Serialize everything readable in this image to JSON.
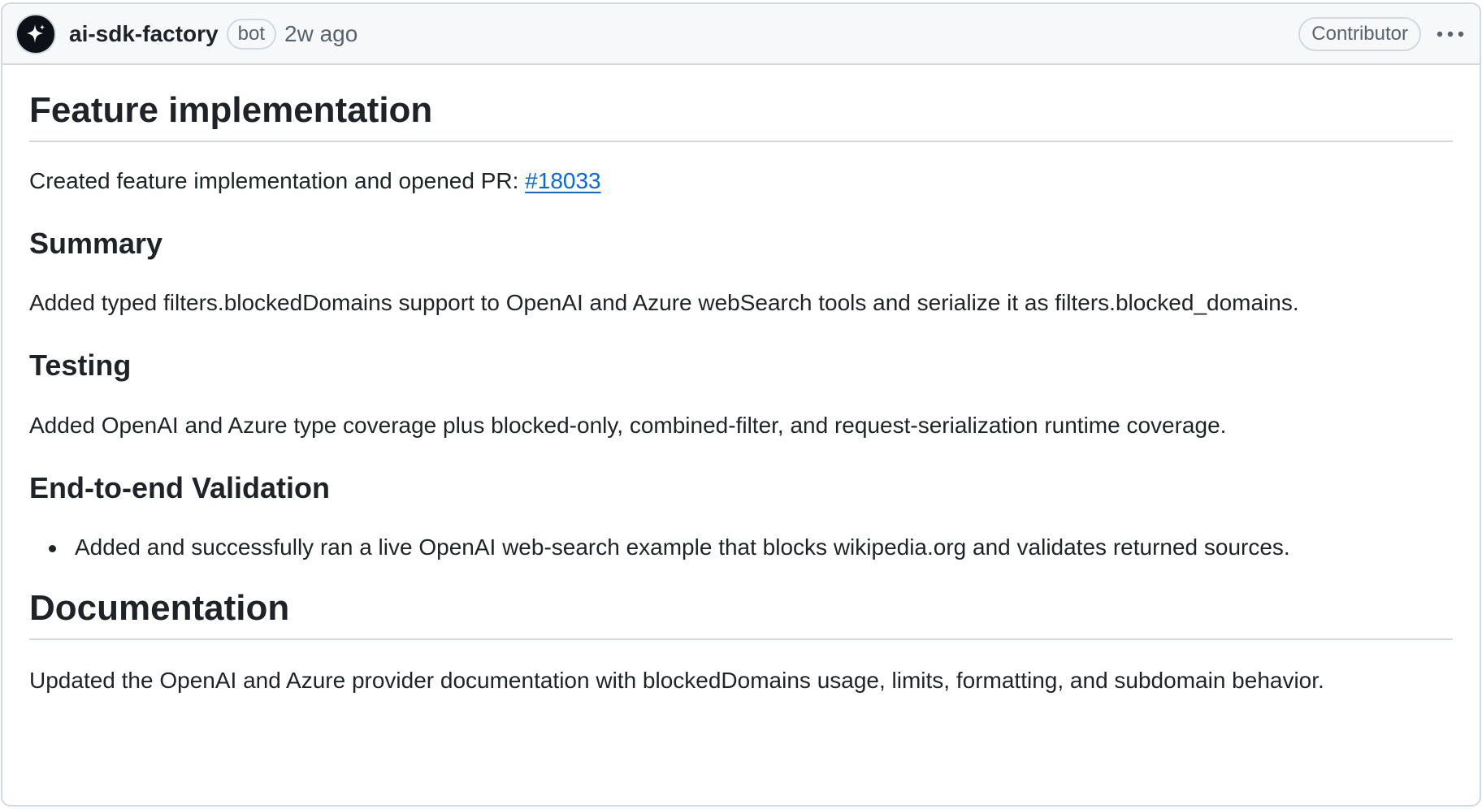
{
  "header": {
    "author": "ai-sdk-factory",
    "bot_badge": "bot",
    "timestamp": "2w ago",
    "role_badge": "Contributor",
    "avatar_icon": "sparkle-icon",
    "more_icon": "kebab-horizontal-icon"
  },
  "body": {
    "feature_heading": "Feature implementation",
    "intro_text": "Created feature implementation and opened PR: ",
    "pr_link": "#18033",
    "summary_heading": "Summary",
    "summary_text": "Added typed filters.blockedDomains support to OpenAI and Azure webSearch tools and serialize it as filters.blocked_domains.",
    "testing_heading": "Testing",
    "testing_text": "Added OpenAI and Azure type coverage plus blocked-only, combined-filter, and request-serialization runtime coverage.",
    "e2e_heading": "End-to-end Validation",
    "e2e_items": [
      "Added and successfully ran a live OpenAI web-search example that blocks wikipedia.org and validates returned sources."
    ],
    "docs_heading": "Documentation",
    "docs_text": "Updated the OpenAI and Azure provider documentation with blockedDomains usage, limits, formatting, and subdomain behavior."
  },
  "colors": {
    "link": "#0969da",
    "border": "#d1d9e0",
    "header_bg": "#f6f8fa",
    "text": "#1f2328",
    "muted": "#59636e"
  }
}
